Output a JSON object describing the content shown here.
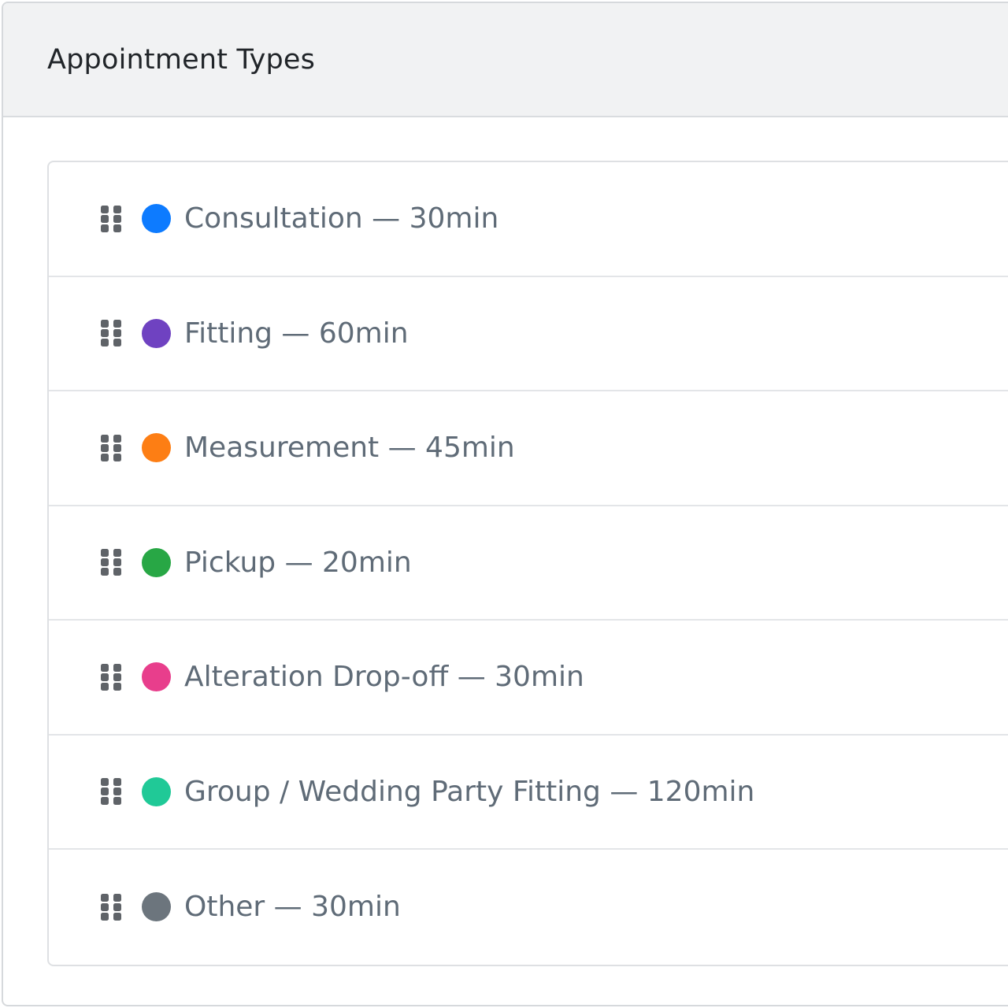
{
  "header": {
    "title": "Appointment Types"
  },
  "appointment_types": [
    {
      "label": "Consultation — 30min",
      "color": "#0d7bff",
      "icon": "drag-handle-icon"
    },
    {
      "label": "Fitting — 60min",
      "color": "#6f42c1",
      "icon": "drag-handle-icon"
    },
    {
      "label": "Measurement — 45min",
      "color": "#fd7e14",
      "icon": "drag-handle-icon"
    },
    {
      "label": "Pickup — 20min",
      "color": "#28a745",
      "icon": "drag-handle-icon"
    },
    {
      "label": "Alteration Drop-off — 30min",
      "color": "#e83e8c",
      "icon": "drag-handle-icon"
    },
    {
      "label": "Group / Wedding Party Fitting — 120min",
      "color": "#20c997",
      "icon": "drag-handle-icon"
    },
    {
      "label": "Other — 30min",
      "color": "#6c757d",
      "icon": "drag-handle-icon"
    }
  ]
}
